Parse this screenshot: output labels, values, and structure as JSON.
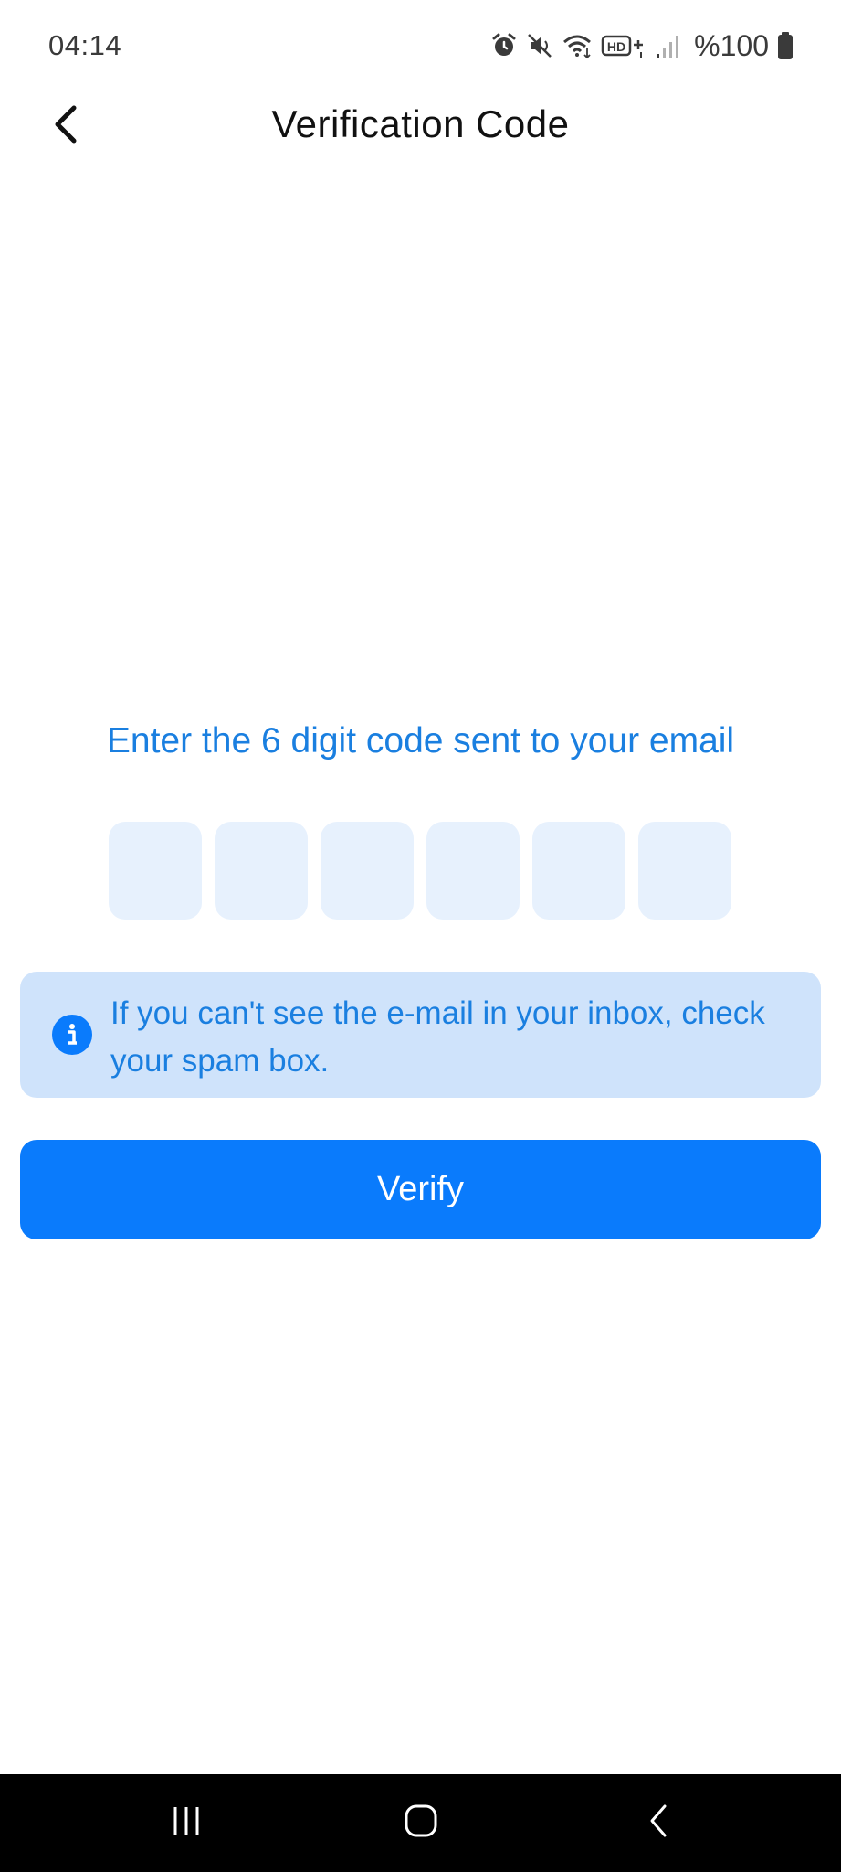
{
  "status_bar": {
    "time": "04:14",
    "battery": "%100",
    "icons": [
      "alarm-icon",
      "mute-icon",
      "wifi-icon",
      "hd-voice-icon",
      "signal-icon",
      "battery-icon"
    ]
  },
  "header": {
    "title": "Verification Code",
    "back_icon": "chevron-left-icon"
  },
  "instruction": "Enter the 6 digit code sent to your email",
  "code": {
    "length": 6,
    "digits": [
      "",
      "",
      "",
      "",
      "",
      ""
    ]
  },
  "info": {
    "icon": "info-icon",
    "text": "If you can't see the e-mail in your inbox, check your spam box."
  },
  "verify_button": {
    "label": "Verify"
  },
  "nav_bar": {
    "icons": [
      "recents-icon",
      "home-icon",
      "back-icon"
    ]
  },
  "colors": {
    "accent": "#0a7bfc",
    "accent_text": "#1a7fe0",
    "code_box_bg": "#e7f1fd",
    "info_bg": "#cfe3fb",
    "nav_bg": "#000000"
  }
}
